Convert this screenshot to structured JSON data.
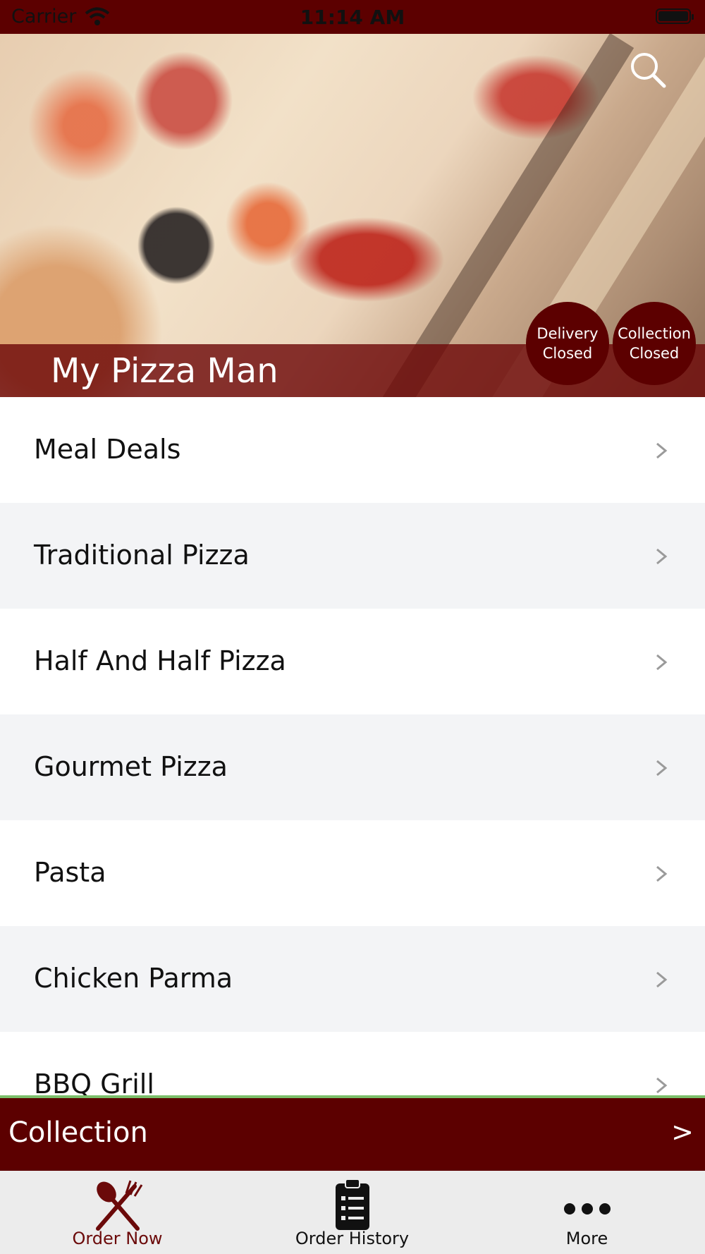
{
  "status_bar": {
    "carrier": "Carrier",
    "time": "11:14 AM",
    "wifi_icon": "wifi-icon",
    "battery_icon": "battery-icon"
  },
  "hero": {
    "restaurant_name": "My Pizza Man",
    "search_icon": "search-icon"
  },
  "status_badges": {
    "delivery": {
      "line1": "Delivery",
      "line2": "Closed"
    },
    "collection": {
      "line1": "Collection",
      "line2": "Closed"
    }
  },
  "menu": {
    "items": [
      {
        "label": "Meal Deals"
      },
      {
        "label": "Traditional Pizza"
      },
      {
        "label": "Half And Half Pizza"
      },
      {
        "label": "Gourmet Pizza"
      },
      {
        "label": "Pasta"
      },
      {
        "label": "Chicken Parma"
      },
      {
        "label": "BBQ Grill"
      }
    ]
  },
  "order_mode": {
    "label": "Collection",
    "arrow": ">"
  },
  "tabs": [
    {
      "label": "Order Now",
      "icon": "fork-knife-icon",
      "active": true
    },
    {
      "label": "Order History",
      "icon": "clipboard-list-icon",
      "active": false
    },
    {
      "label": "More",
      "icon": "more-dots-icon",
      "active": false
    }
  ],
  "colors": {
    "brand": "#5c0000",
    "active_tab": "#6b0a0a",
    "accent_line": "#7bbf6a",
    "alt_row": "#f3f4f6"
  }
}
